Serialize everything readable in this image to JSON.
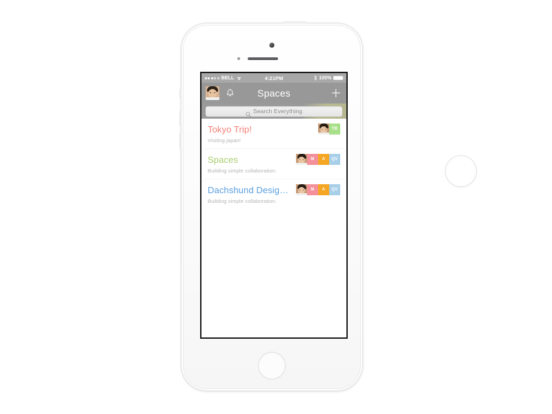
{
  "device": {
    "name": "iPhone 5s White",
    "camera_icon": "camera-icon",
    "sensor_icon": "proximity-sensor-icon",
    "speaker_icon": "earpiece-speaker-icon",
    "home_button_label": "Home"
  },
  "status_bar": {
    "signal_dots": "•••oo",
    "carrier": "BELL",
    "wifi_icon": "wifi-icon",
    "time": "4:21PM",
    "bluetooth_icon": "bluetooth-icon",
    "battery_percent": "100%",
    "battery_icon": "battery-full-icon"
  },
  "nav_bar": {
    "avatar_name": "user-avatar",
    "bell_icon": "bell-icon",
    "title": "Spaces",
    "add_label": "+"
  },
  "search": {
    "icon": "search-icon",
    "placeholder": "Search Everything",
    "value": ""
  },
  "spaces": [
    {
      "title": "Tokyo Trip!",
      "title_color": "#f08077",
      "subtitle": "Visiting japan!",
      "members": [
        {
          "type": "photo",
          "initials": "",
          "color": "#c79a76"
        },
        {
          "type": "initials",
          "initials": "TB",
          "color": "#a8e08a"
        }
      ]
    },
    {
      "title": "Spaces",
      "title_color": "#a9cc6e",
      "subtitle": "Building simple collaboration.",
      "members": [
        {
          "type": "photo",
          "initials": "",
          "color": "#c79a76"
        },
        {
          "type": "initials",
          "initials": "M",
          "color": "#f3909a"
        },
        {
          "type": "initials",
          "initials": "A",
          "color": "#f5a623"
        },
        {
          "type": "initials",
          "initials": "QV",
          "color": "#a8cfe8"
        }
      ]
    },
    {
      "title": "Dachshund Desig…",
      "title_color": "#5a9fe0",
      "subtitle": "Building simple collaboration.",
      "members": [
        {
          "type": "photo",
          "initials": "",
          "color": "#c79a76"
        },
        {
          "type": "initials",
          "initials": "M",
          "color": "#f3909a"
        },
        {
          "type": "initials",
          "initials": "A",
          "color": "#f5a623"
        },
        {
          "type": "initials",
          "initials": "QV",
          "color": "#a8cfe8"
        }
      ]
    }
  ],
  "cursor": {
    "name": "touch-indicator"
  }
}
